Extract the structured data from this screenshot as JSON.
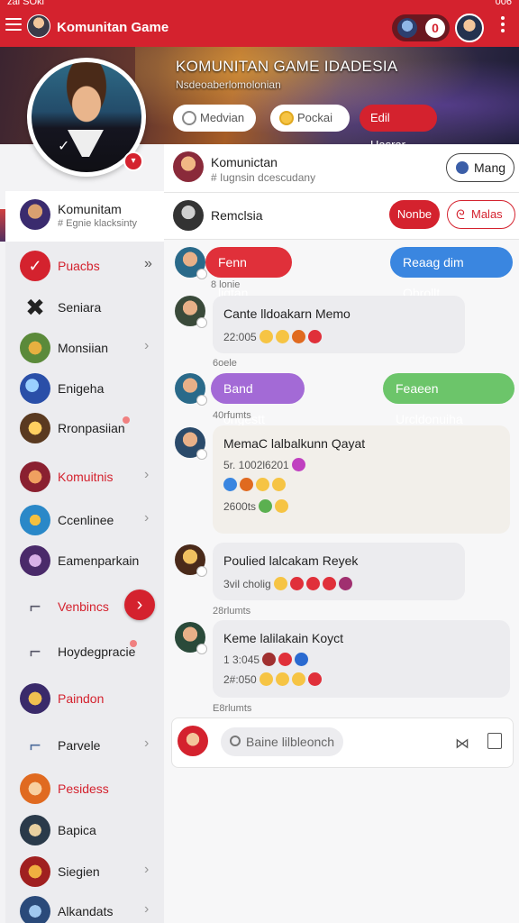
{
  "status": {
    "left": "zai SOki",
    "right": "006"
  },
  "appbar": {
    "title": "Komunitan Game",
    "counter": "0"
  },
  "banner": {
    "title": "KOMUNITAN GAME IDADESIA",
    "subtitle": "Nsdeoaberlomolonian",
    "pills": [
      "Medvian",
      "Pockai",
      "Edil Hasrar"
    ]
  },
  "sidebar": {
    "header": {
      "title": "Komunitam",
      "subtitle": "# Egnie klacksinty"
    },
    "items": [
      {
        "label": "Puacbs",
        "red": true
      },
      {
        "label": "Seniara"
      },
      {
        "label": "Monsiian"
      },
      {
        "label": "Enigeha"
      },
      {
        "label": "Rronpasiian"
      },
      {
        "label": "Komuitnis",
        "red": true
      },
      {
        "label": "Ccenlinee"
      },
      {
        "label": "Eamenparkain"
      },
      {
        "label": "Venbincs",
        "red": true
      },
      {
        "label": "Hoydegpracie"
      },
      {
        "label": "Paindon",
        "red": true
      },
      {
        "label": "Parvele"
      },
      {
        "label": "Pesidess",
        "red": true
      },
      {
        "label": "Bapica"
      },
      {
        "label": "Siegien"
      },
      {
        "label": "Alkandats"
      }
    ]
  },
  "group": {
    "title": "Komunictan",
    "subtitle": "# Iugnsin dcescudany",
    "button": "Mang"
  },
  "tools": {
    "title": "Remclsia",
    "primary": "Nonbe",
    "secondary": "Malas"
  },
  "chat": {
    "bubble_red": "Fenn ligtan",
    "bubble_blue": "Reaag dim Obrollt",
    "meta1": "8 lonie",
    "msg1": {
      "title": "Cante lldoakarn Memo",
      "line1": "22:005"
    },
    "meta2": "6oele",
    "bubble_purple": "Band ohgestt",
    "bubble_green": "Feaeen Urcldonuiha",
    "meta3": "40rfumts",
    "msg2": {
      "title": "MemaC lalbalkunn Qayat",
      "line1": "5r. 1002l6201",
      "line2": "",
      "line3": "2600ts"
    },
    "msg3": {
      "title": "Poulied lalcakam Reyek",
      "line1": "3vil cholig"
    },
    "meta4": "28rlumts",
    "msg4": {
      "title": "Keme lalilakain Koyct",
      "line1": "1 3:045",
      "line2": "2#:050"
    },
    "meta5": "E8rlumts"
  },
  "composer": {
    "placeholder": "Baine lilbleonch"
  }
}
